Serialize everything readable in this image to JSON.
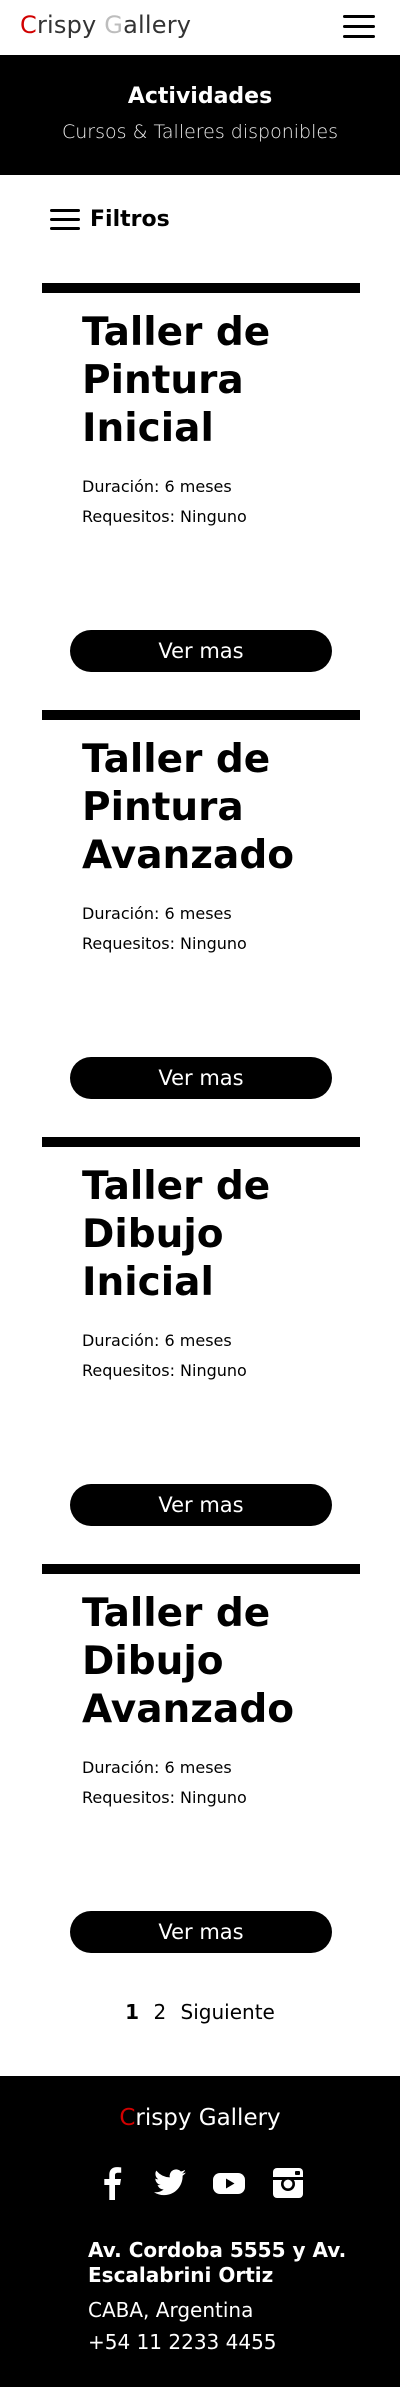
{
  "header": {
    "logo": {
      "first_letter": "C",
      "part1": "rispy ",
      "g_letter": "G",
      "part2": "allery"
    },
    "menu_icon": "hamburger-menu-icon"
  },
  "hero": {
    "title": "Actividades",
    "subtitle": "Cursos & Talleres disponibles"
  },
  "filters": {
    "label": "Filtros",
    "icon": "filter-lines-icon"
  },
  "courses": [
    {
      "title": "Taller de Pintura Inicial",
      "duration": "Duración: 6 meses",
      "requirements": "Requesitos: Ninguno",
      "button": "Ver mas"
    },
    {
      "title": "Taller de Pintura Avanzado",
      "duration": "Duración: 6 meses",
      "requirements": "Requesitos: Ninguno",
      "button": "Ver mas"
    },
    {
      "title": "Taller de Dibujo Inicial",
      "duration": "Duración: 6 meses",
      "requirements": "Requesitos: Ninguno",
      "button": "Ver mas"
    },
    {
      "title": "Taller de Dibujo Avanzado",
      "duration": "Duración: 6 meses",
      "requirements": "Requesitos: Ninguno",
      "button": "Ver mas"
    }
  ],
  "pagination": {
    "pages": [
      "1",
      "2"
    ],
    "current": "1",
    "next": "Siguiente"
  },
  "footer": {
    "logo": {
      "first_letter": "C",
      "rest": "rispy Gallery"
    },
    "socials": [
      "facebook-icon",
      "twitter-icon",
      "youtube-icon",
      "instagram-icon"
    ],
    "address": "Av. Cordoba 5555 y Av. Escalabrini Ortiz",
    "city": "CABA, Argentina",
    "phone": "+54 11 2233 4455"
  },
  "colors": {
    "accent": "#d10000",
    "logo_g": "#bdbdbd",
    "dark": "#000000",
    "background": "#ffffff"
  }
}
